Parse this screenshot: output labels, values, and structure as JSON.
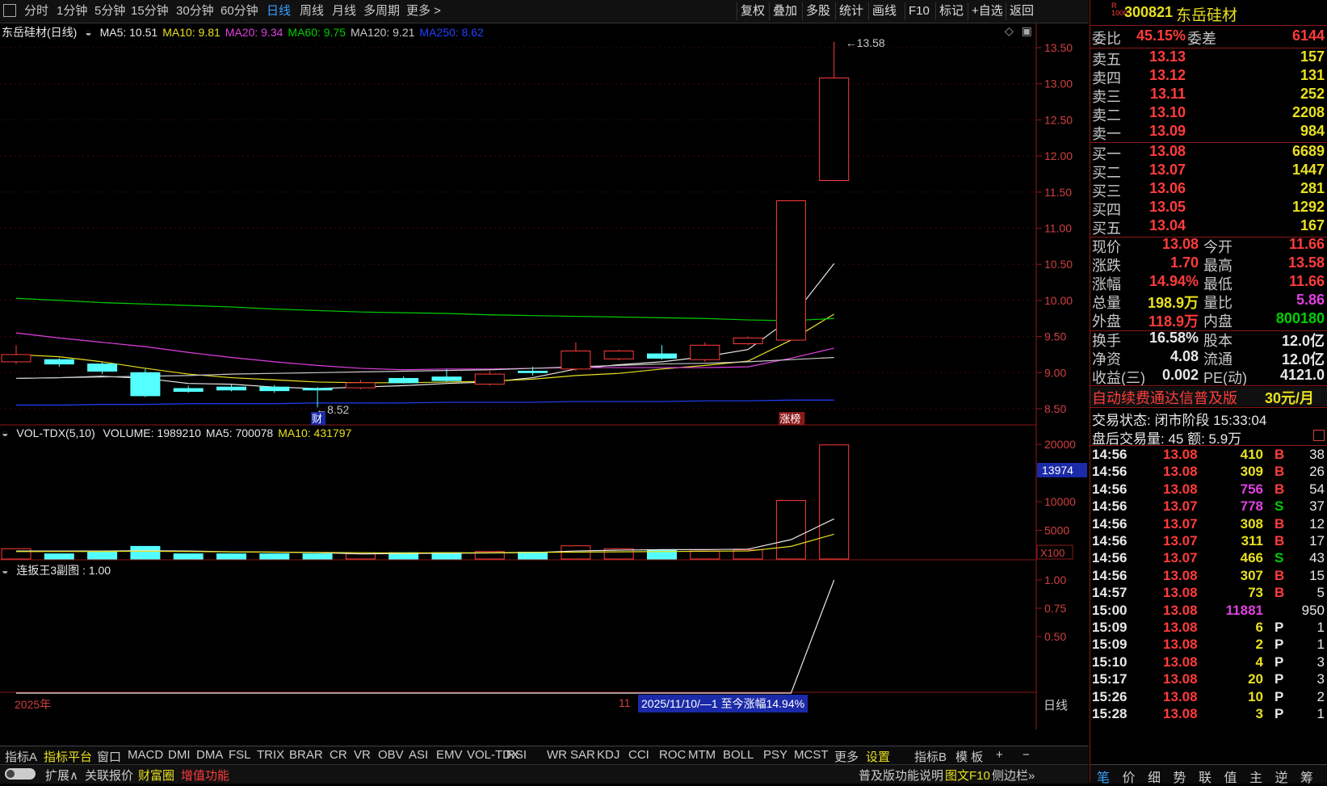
{
  "toolbar": {
    "periods": [
      "分时",
      "1分钟",
      "5分钟",
      "15分钟",
      "30分钟",
      "60分钟",
      "日线",
      "周线",
      "月线",
      "多周期",
      "更多 >"
    ],
    "active_period": "日线",
    "tools": [
      "复权",
      "叠加",
      "多股",
      "统计",
      "画线",
      "F10",
      "标记",
      "+自选",
      "返回"
    ]
  },
  "main_chart": {
    "title": "东岳硅材(日线)",
    "ma": [
      {
        "label": "MA5: 10.51",
        "color": "#e8e8e8"
      },
      {
        "label": "MA10: 9.81",
        "color": "#e8e020"
      },
      {
        "label": "MA20: 9.34",
        "color": "#e040e0"
      },
      {
        "label": "MA60: 9.75",
        "color": "#00d000"
      },
      {
        "label": "MA120: 9.21",
        "color": "#c8c8c8"
      },
      {
        "label": "MA250: 8.62",
        "color": "#2040ff"
      }
    ],
    "yticks": [
      "13.50",
      "13.00",
      "12.50",
      "12.00",
      "11.50",
      "11.00",
      "10.50",
      "10.00",
      "9.50",
      "9.00",
      "8.50"
    ],
    "high_label": "13.58",
    "low_label": "8.52",
    "marker_cai": "财",
    "marker_zhangting": "涨榜"
  },
  "volume_chart": {
    "title": "VOL-TDX(5,10)",
    "legend": [
      {
        "label": "VOLUME: 1989210",
        "color": "#e8e8e8"
      },
      {
        "label": "MA5: 700078",
        "color": "#e8e8e8"
      },
      {
        "label": "MA10: 431797",
        "color": "#e8e020"
      }
    ],
    "yticks": [
      "20000",
      "10000",
      "5000"
    ],
    "highlight": "13974",
    "unit": "X100"
  },
  "indicator_chart": {
    "title": "连扳王3副图 : 1.00",
    "yticks": [
      "1.00",
      "0.75",
      "0.50"
    ]
  },
  "timeline": {
    "year": "2025年",
    "month": "11",
    "range_text": "2025/11/10/—1 至今涨幅14.94%",
    "period_label": "日线"
  },
  "chart_data": {
    "type": "candlestick",
    "y_range": [
      8.4,
      13.7
    ],
    "candles": [
      {
        "open": 9.15,
        "close": 9.25,
        "high": 9.38,
        "low": 9.12
      },
      {
        "open": 9.18,
        "close": 9.12,
        "high": 9.2,
        "low": 9.08
      },
      {
        "open": 9.12,
        "close": 9.02,
        "high": 9.14,
        "low": 8.98
      },
      {
        "open": 9.0,
        "close": 8.68,
        "high": 9.05,
        "low": 8.66
      },
      {
        "open": 8.78,
        "close": 8.74,
        "high": 8.82,
        "low": 8.72
      },
      {
        "open": 8.8,
        "close": 8.76,
        "high": 8.84,
        "low": 8.74
      },
      {
        "open": 8.8,
        "close": 8.75,
        "high": 8.83,
        "low": 8.72
      },
      {
        "open": 8.78,
        "close": 8.76,
        "high": 8.8,
        "low": 8.52
      },
      {
        "open": 8.79,
        "close": 8.86,
        "high": 8.9,
        "low": 8.77
      },
      {
        "open": 8.92,
        "close": 8.86,
        "high": 8.95,
        "low": 8.85
      },
      {
        "open": 8.94,
        "close": 8.89,
        "high": 9.05,
        "low": 8.87
      },
      {
        "open": 8.84,
        "close": 8.98,
        "high": 9.02,
        "low": 8.82
      },
      {
        "open": 9.02,
        "close": 9.0,
        "high": 9.08,
        "low": 8.96
      },
      {
        "open": 9.05,
        "close": 9.3,
        "high": 9.42,
        "low": 9.02
      },
      {
        "open": 9.19,
        "close": 9.3,
        "high": 9.32,
        "low": 9.17
      },
      {
        "open": 9.26,
        "close": 9.2,
        "high": 9.38,
        "low": 9.18
      },
      {
        "open": 9.18,
        "close": 9.38,
        "high": 9.42,
        "low": 9.15
      },
      {
        "open": 9.4,
        "close": 9.48,
        "high": 9.5,
        "low": 9.38
      },
      {
        "open": 9.45,
        "close": 11.38,
        "high": 11.38,
        "low": 9.45
      },
      {
        "open": 11.66,
        "close": 13.08,
        "high": 13.58,
        "low": 11.66
      }
    ],
    "volume": [
      1800,
      900,
      1300,
      2200,
      900,
      900,
      900,
      900,
      900,
      1100,
      1100,
      1300,
      1200,
      2300,
      1800,
      1500,
      1400,
      1600,
      10200,
      19892
    ],
    "ma_series": [
      {
        "name": "MA5",
        "color": "#e8e8e8",
        "values": [
          8.92,
          8.93,
          8.95,
          8.92,
          8.85,
          8.84,
          8.8,
          8.78,
          8.8,
          8.82,
          8.85,
          8.87,
          8.93,
          9.05,
          9.11,
          9.15,
          9.22,
          9.32,
          9.75,
          10.51
        ]
      },
      {
        "name": "MA10",
        "color": "#e8e020",
        "values": [
          9.25,
          9.22,
          9.15,
          9.06,
          8.98,
          8.93,
          8.9,
          8.87,
          8.86,
          8.86,
          8.87,
          8.88,
          8.91,
          8.96,
          8.99,
          9.05,
          9.1,
          9.16,
          9.45,
          9.81
        ]
      },
      {
        "name": "MA20",
        "color": "#e040e0",
        "values": [
          9.55,
          9.48,
          9.42,
          9.36,
          9.28,
          9.21,
          9.15,
          9.1,
          9.06,
          9.04,
          9.05,
          9.05,
          9.06,
          9.07,
          9.07,
          9.07,
          9.07,
          9.08,
          9.2,
          9.34
        ]
      },
      {
        "name": "MA60",
        "color": "#00d000",
        "values": [
          10.03,
          10.0,
          9.97,
          9.95,
          9.93,
          9.91,
          9.88,
          9.86,
          9.84,
          9.83,
          9.82,
          9.8,
          9.79,
          9.78,
          9.77,
          9.76,
          9.75,
          9.73,
          9.72,
          9.75
        ]
      },
      {
        "name": "MA120",
        "color": "#c8c8c8",
        "values": [
          8.92,
          8.93,
          8.94,
          8.95,
          8.96,
          8.98,
          8.99,
          9.0,
          9.01,
          9.02,
          9.03,
          9.04,
          9.06,
          9.08,
          9.1,
          9.12,
          9.13,
          9.15,
          9.18,
          9.21
        ]
      },
      {
        "name": "MA250",
        "color": "#2040ff",
        "values": [
          8.55,
          8.55,
          8.56,
          8.56,
          8.57,
          8.57,
          8.57,
          8.58,
          8.58,
          8.58,
          8.59,
          8.59,
          8.59,
          8.6,
          8.6,
          8.6,
          8.61,
          8.61,
          8.62,
          8.62
        ]
      }
    ],
    "vol_ma": [
      {
        "name": "MA5",
        "color": "#e8e8e8",
        "values": [
          1400,
          1400,
          1400,
          1450,
          1400,
          1250,
          1200,
          1100,
          900,
          950,
          1000,
          1050,
          1120,
          1400,
          1540,
          1640,
          1640,
          1720,
          3380,
          7000
        ]
      },
      {
        "name": "MA10",
        "color": "#e8e020",
        "values": [
          1300,
          1300,
          1320,
          1350,
          1300,
          1250,
          1200,
          1150,
          1100,
          1050,
          1080,
          1100,
          1150,
          1200,
          1250,
          1300,
          1350,
          1400,
          2200,
          4318
        ]
      }
    ],
    "indicator": [
      0,
      0,
      0,
      0,
      0,
      0,
      0,
      0,
      0,
      0,
      0,
      0,
      0,
      0,
      0,
      0,
      0,
      0,
      0,
      1.0
    ]
  },
  "indicator_tabs": [
    "指标A",
    "指标平台",
    "窗口",
    "MACD",
    "DMI",
    "DMA",
    "FSL",
    "TRIX",
    "BRAR",
    "CR",
    "VR",
    "OBV",
    "ASI",
    "EMV",
    "VOL-TDX",
    "RSI",
    "WR",
    "SAR",
    "KDJ",
    "CCI",
    "ROC",
    "MTM",
    "BOLL",
    "PSY",
    "MCST",
    "更多",
    "设置",
    "指标B",
    "模 板",
    "+",
    "−"
  ],
  "bottom_bar": [
    "扩展∧",
    "关联报价",
    "财富圈",
    "增值功能"
  ],
  "bottom_right": [
    "普及版功能说明",
    "图文F10",
    "侧边栏»"
  ],
  "stock": {
    "badge_top": "R",
    "badge_bottom": "1000",
    "code": "300821",
    "name": "东岳硅材",
    "webi_label": "委比",
    "webi": "45.15%",
    "weicha_label": "委差",
    "weicha": "6144",
    "asks": [
      {
        "label": "卖五",
        "price": "13.13",
        "vol": "157"
      },
      {
        "label": "卖四",
        "price": "13.12",
        "vol": "131"
      },
      {
        "label": "卖三",
        "price": "13.11",
        "vol": "252"
      },
      {
        "label": "卖二",
        "price": "13.10",
        "vol": "2208"
      },
      {
        "label": "卖一",
        "price": "13.09",
        "vol": "984"
      }
    ],
    "bids": [
      {
        "label": "买一",
        "price": "13.08",
        "vol": "6689"
      },
      {
        "label": "买二",
        "price": "13.07",
        "vol": "1447"
      },
      {
        "label": "买三",
        "price": "13.06",
        "vol": "281"
      },
      {
        "label": "买四",
        "price": "13.05",
        "vol": "1292"
      },
      {
        "label": "买五",
        "price": "13.04",
        "vol": "167"
      }
    ],
    "quote": [
      {
        "l1": "现价",
        "v1": "13.08",
        "c1": "red",
        "l2": "今开",
        "v2": "11.66",
        "c2": "red"
      },
      {
        "l1": "涨跌",
        "v1": "1.70",
        "c1": "red",
        "l2": "最高",
        "v2": "13.58",
        "c2": "red"
      },
      {
        "l1": "涨幅",
        "v1": "14.94%",
        "c1": "red",
        "l2": "最低",
        "v2": "11.66",
        "c2": "red"
      },
      {
        "l1": "总量",
        "v1": "198.9万",
        "c1": "yellow",
        "l2": "量比",
        "v2": "5.86",
        "c2": "magenta"
      },
      {
        "l1": "外盘",
        "v1": "118.9万",
        "c1": "red",
        "l2": "内盘",
        "v2": "800180",
        "c2": "green"
      }
    ],
    "fund": [
      {
        "l1": "换手",
        "v1": "16.58%",
        "l2": "股本",
        "v2": "12.0亿"
      },
      {
        "l1": "净资",
        "v1": "4.08",
        "l2": "流通",
        "v2": "12.0亿"
      },
      {
        "l1": "收益(三)",
        "v1": "0.002",
        "l2": "PE(动)",
        "v2": "4121.0"
      }
    ],
    "promo": "自动续费通达信普及版",
    "promo_price": "30元/月",
    "trade_status": "交易状态: 闭市阶段 15:33:04",
    "after_hours": "盘后交易量: 45  额: 5.9万",
    "ticks": [
      {
        "t": "14:56",
        "p": "13.08",
        "v": "410",
        "vc": "yellow",
        "d": "B",
        "n": "38"
      },
      {
        "t": "14:56",
        "p": "13.08",
        "v": "309",
        "vc": "yellow",
        "d": "B",
        "n": "26"
      },
      {
        "t": "14:56",
        "p": "13.08",
        "v": "756",
        "vc": "magenta",
        "d": "B",
        "n": "54"
      },
      {
        "t": "14:56",
        "p": "13.07",
        "v": "778",
        "vc": "magenta",
        "d": "S",
        "n": "37"
      },
      {
        "t": "14:56",
        "p": "13.07",
        "v": "308",
        "vc": "yellow",
        "d": "B",
        "n": "12"
      },
      {
        "t": "14:56",
        "p": "13.07",
        "v": "311",
        "vc": "yellow",
        "d": "B",
        "n": "17"
      },
      {
        "t": "14:56",
        "p": "13.07",
        "v": "466",
        "vc": "yellow",
        "d": "S",
        "n": "43"
      },
      {
        "t": "14:56",
        "p": "13.08",
        "v": "307",
        "vc": "yellow",
        "d": "B",
        "n": "15"
      },
      {
        "t": "14:57",
        "p": "13.08",
        "v": "73",
        "vc": "yellow",
        "d": "B",
        "n": "5"
      },
      {
        "t": "15:00",
        "p": "13.08",
        "v": "11881",
        "vc": "magenta",
        "d": "",
        "n": "950"
      },
      {
        "t": "15:09",
        "p": "13.08",
        "v": "6",
        "vc": "yellow",
        "d": "P",
        "n": "1"
      },
      {
        "t": "15:09",
        "p": "13.08",
        "v": "2",
        "vc": "yellow",
        "d": "P",
        "n": "1"
      },
      {
        "t": "15:10",
        "p": "13.08",
        "v": "4",
        "vc": "yellow",
        "d": "P",
        "n": "3"
      },
      {
        "t": "15:17",
        "p": "13.08",
        "v": "20",
        "vc": "yellow",
        "d": "P",
        "n": "3"
      },
      {
        "t": "15:26",
        "p": "13.08",
        "v": "10",
        "vc": "yellow",
        "d": "P",
        "n": "2"
      },
      {
        "t": "15:28",
        "p": "13.08",
        "v": "3",
        "vc": "yellow",
        "d": "P",
        "n": "1"
      }
    ],
    "right_tabs": [
      "笔",
      "价",
      "细",
      "势",
      "联",
      "值",
      "主",
      "逆",
      "筹"
    ]
  }
}
